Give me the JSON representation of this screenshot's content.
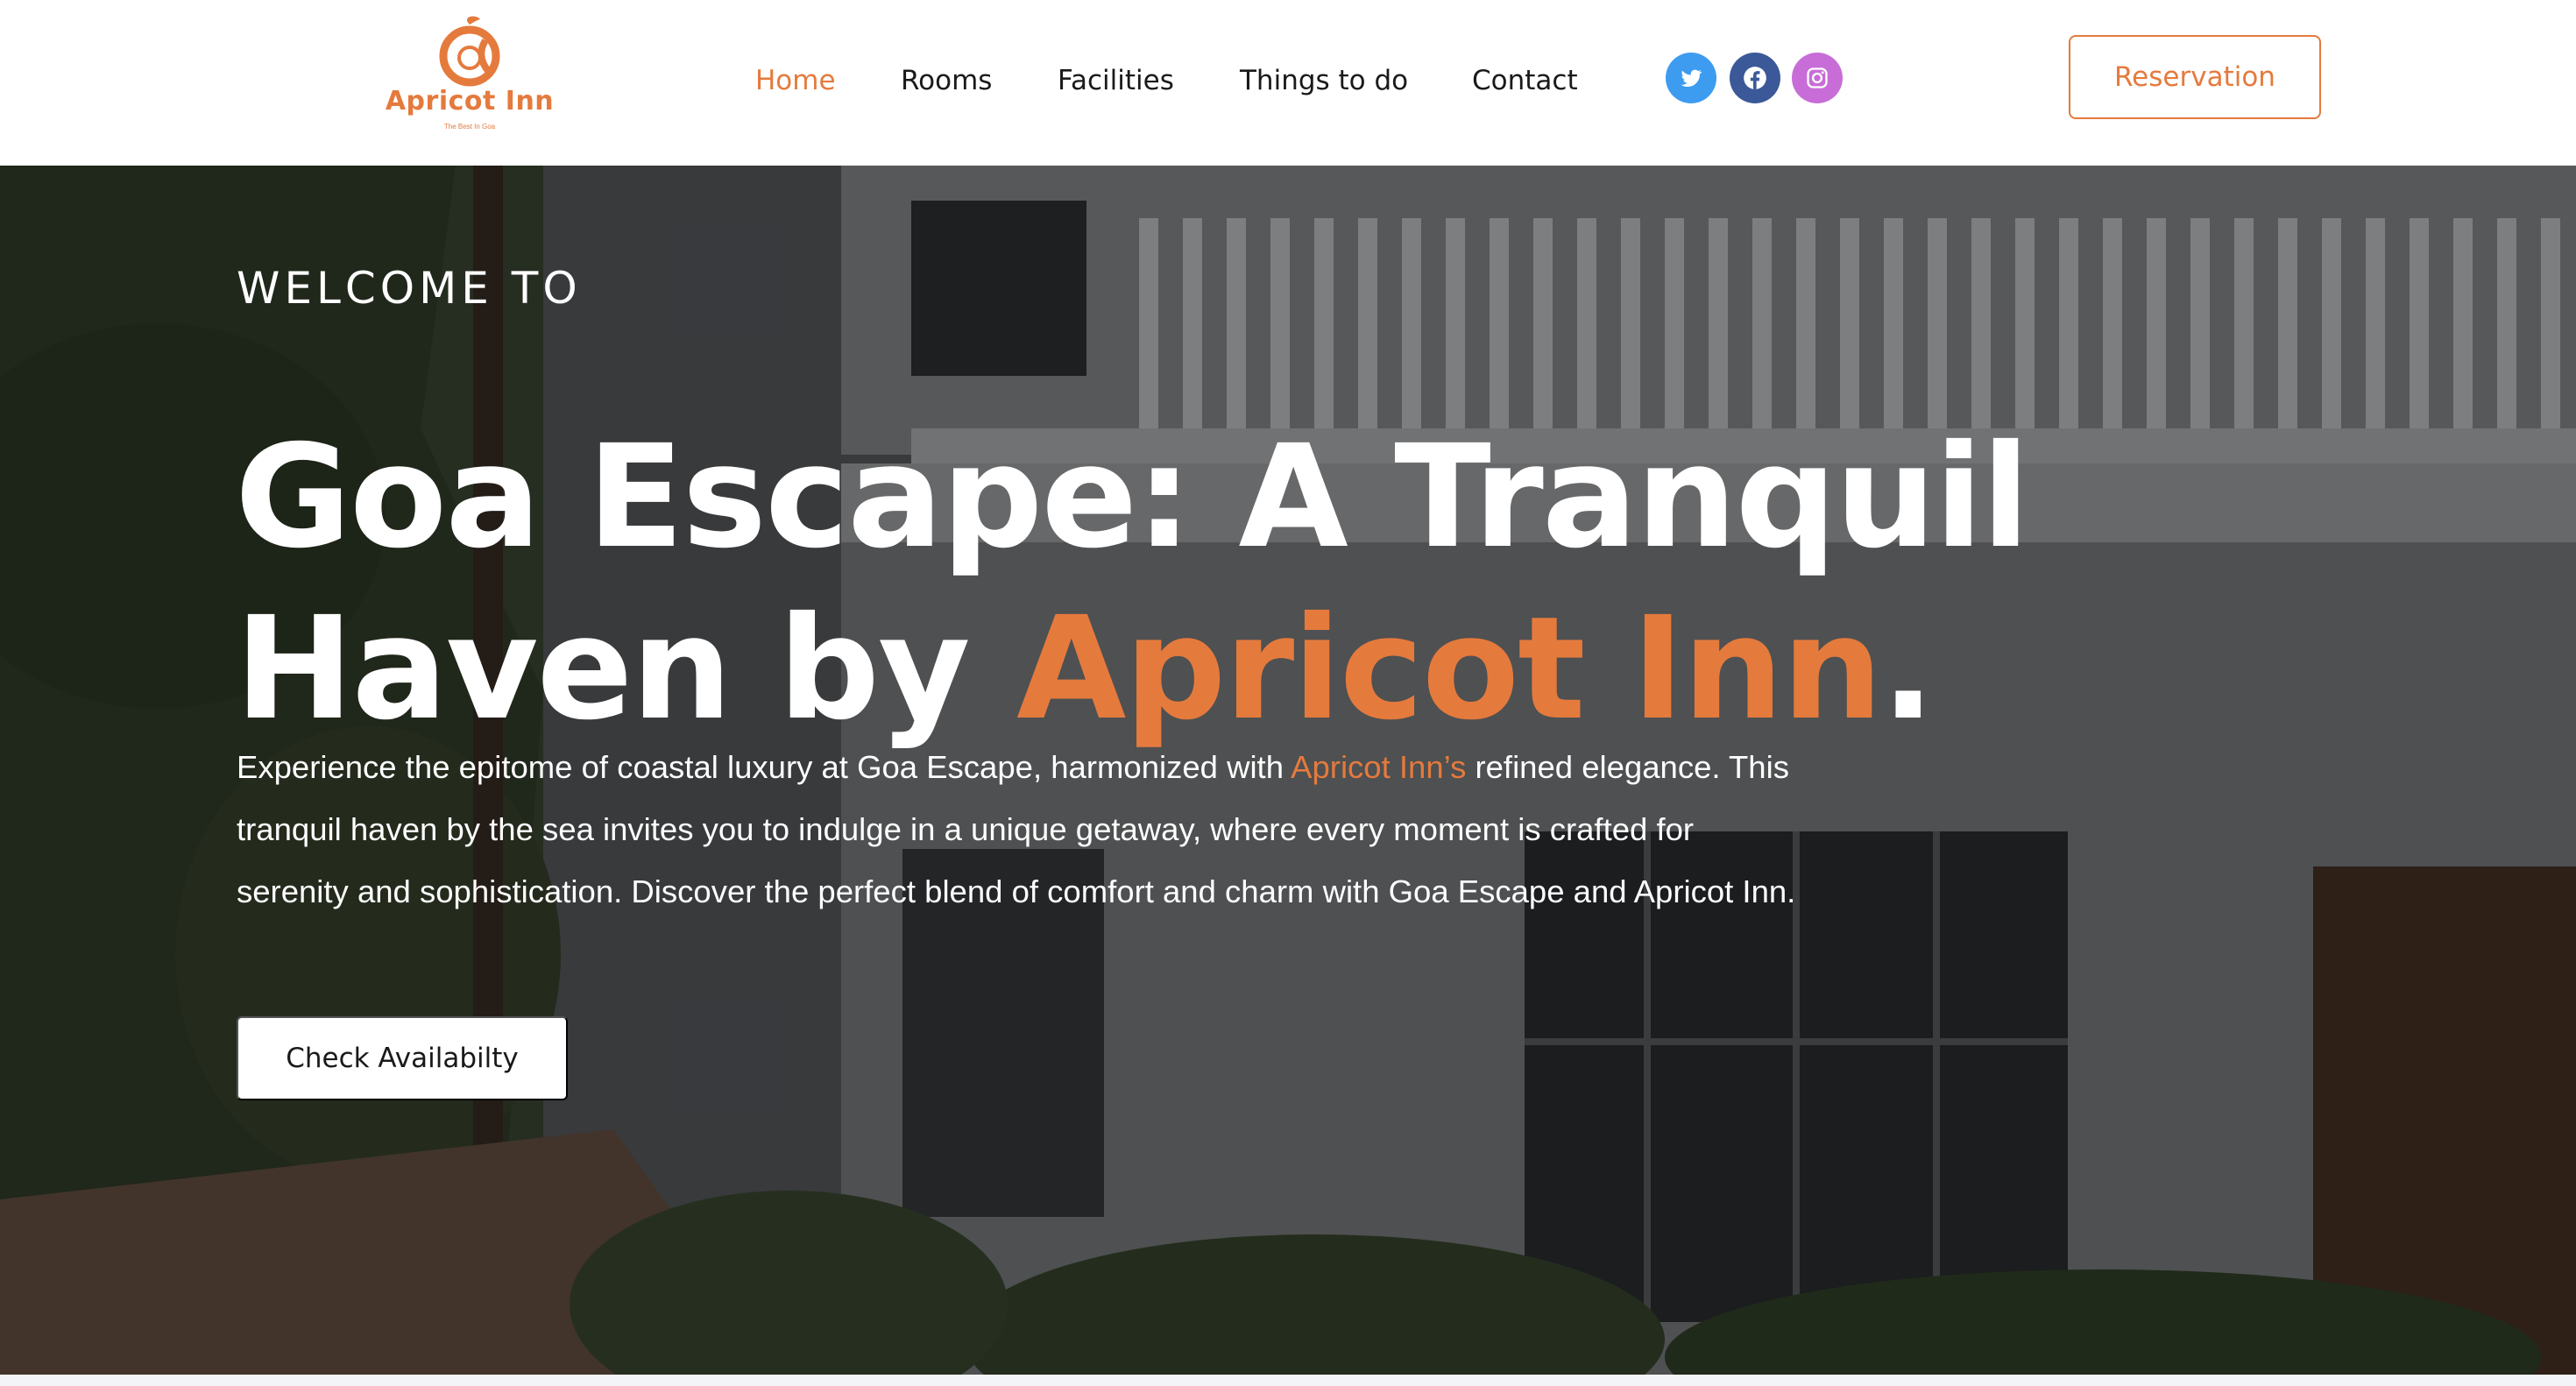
{
  "brand": {
    "name": "Apricot Inn",
    "tagline": "The Best In Goa",
    "accent_color": "#e57a3d"
  },
  "nav": {
    "items": [
      {
        "label": "Home",
        "active": true
      },
      {
        "label": "Rooms",
        "active": false
      },
      {
        "label": "Facilities",
        "active": false
      },
      {
        "label": "Things to do",
        "active": false
      },
      {
        "label": "Contact",
        "active": false
      }
    ]
  },
  "social": {
    "icons": [
      "twitter-icon",
      "facebook-icon",
      "instagram-icon"
    ],
    "colors": [
      "#3d9cf0",
      "#3b5998",
      "#c86dd7"
    ]
  },
  "header": {
    "reservation_label": "Reservation"
  },
  "hero": {
    "welcome": "WELCOME TO",
    "headline_part1": "Goa Escape: A Tranquil Haven by ",
    "headline_accent": "Apricot Inn",
    "headline_end": ".",
    "desc_part1": "Experience the epitome of coastal luxury at Goa Escape, harmonized with ",
    "desc_accent": "Apricot Inn’s",
    "desc_part2": " refined elegance. This tranquil haven by the sea invites you to indulge in a unique getaway, where every moment is crafted for serenity and sophistication. Discover the perfect blend of comfort and charm with Goa Escape and Apricot Inn.",
    "cta_label": "Check Availabilty"
  }
}
